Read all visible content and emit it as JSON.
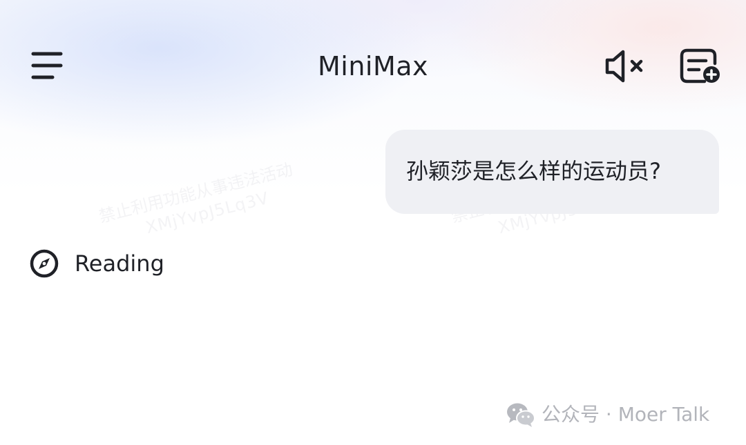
{
  "header": {
    "title": "MiniMax",
    "menu_icon": "hamburger-menu-icon",
    "mute_icon": "speaker-muted-icon",
    "new_chat_icon": "new-chat-icon"
  },
  "conversation": {
    "user_message": "孙颖莎是怎么样的运动员?",
    "status": {
      "icon": "compass-icon",
      "label": "Reading"
    }
  },
  "watermark": {
    "line1": "禁止利用功能从事违法活动",
    "line2": "XMjYvpJ5Lq3V"
  },
  "footer": {
    "logo_icon": "wechat-icon",
    "text": "公众号 · Moer Talk"
  },
  "colors": {
    "text_primary": "#1f2127",
    "bubble_background": "#eff0f4",
    "footer_text": "#b2b4ba"
  }
}
